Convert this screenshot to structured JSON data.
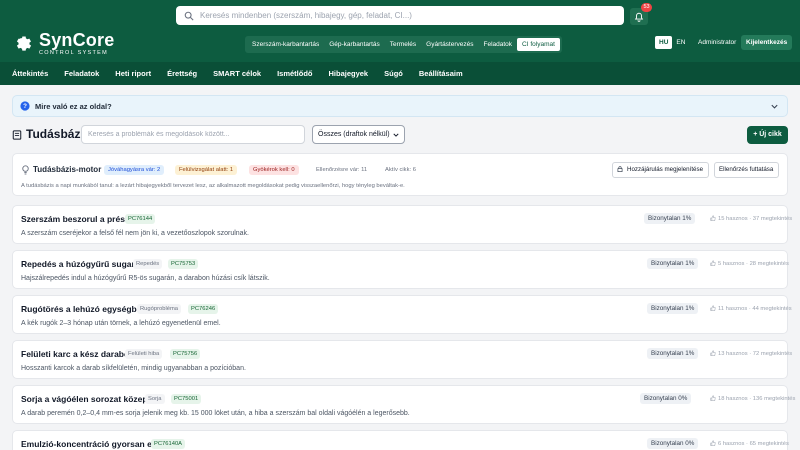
{
  "header": {
    "brand": "SynCore",
    "subbrand": "CONTROL SYSTEM",
    "search_placeholder": "Keresés mindenben (szerszám, hibajegy, gép, feladat, CI...)",
    "notifications_count": "53",
    "modules": [
      {
        "label": "Szerszám-karbantartás",
        "active": false
      },
      {
        "label": "Gép-karbantartás",
        "active": false
      },
      {
        "label": "Termelés",
        "active": false
      },
      {
        "label": "Gyártástervezés",
        "active": false
      },
      {
        "label": "Feladatok",
        "active": false
      },
      {
        "label": "CI folyamat",
        "active": true
      }
    ],
    "lang_hu": "HU",
    "lang_en": "EN",
    "user": "Administrator",
    "logout": "Kijelentkezés"
  },
  "nav": {
    "items": [
      "Áttekintés",
      "Feladatok",
      "Heti riport",
      "Érettség",
      "SMART célok",
      "Ismétlődő",
      "Hibajegyek",
      "Súgó",
      "Beállításaim"
    ]
  },
  "help": {
    "question": "Mire való ez az oldal?"
  },
  "page": {
    "title": "Tudásbázis",
    "search_placeholder": "Keresés a problémák és megoldások között...",
    "filter_value": "Összes (draftok nélkül)",
    "new_button": "+ Új cikk"
  },
  "engine": {
    "title": "Tudásbázis-motor",
    "pending": "Jóváhagyásra vár: 2",
    "review": "Felülvizsgálat alatt: 1",
    "root_cause": "Gyökérok kell: 0",
    "to_check": "Ellenőrzésre vár: 11",
    "active": "Aktív cikk: 6",
    "description": "A tudásbázis a napi munkából tanul: a lezárt hibajegyekből tervezet lesz, az alkalmazott megoldásokat pedig visszaellenőrzi, hogy tényleg beváltak-e.",
    "btn_contrib": "Hozzájárulás megjelenítése",
    "btn_run": "Ellenőrzés futtatása"
  },
  "articles": [
    {
      "title": "Szerszám beszorul a présbe",
      "tag": "",
      "code": "PC76144",
      "desc": "A szerszám cseréjekor a felső fél nem jön ki, a vezetőoszlopok szorulnak.",
      "confidence": "Bizonytalan 1%",
      "stats": "15 hasznos · 37 megtekintés"
    },
    {
      "title": "Repedés a húzógyűrű sugarán",
      "tag": "Repedés",
      "code": "PC75753",
      "desc": "Hajszálrepedés indul a húzógyűrű R5-ös sugarán, a darabon húzási csík látszik.",
      "confidence": "Bizonytalan 1%",
      "stats": "5 hasznos · 28 megtekintés"
    },
    {
      "title": "Rugótörés a lehúzó egységben",
      "tag": "Rugóprobléma",
      "code": "PC76246",
      "desc": "A kék rugók 2–3 hónap után törnek, a lehúzó egyenetlenül emel.",
      "confidence": "Bizonytalan 1%",
      "stats": "11 hasznos · 44 megtekintés"
    },
    {
      "title": "Felületi karc a kész darabon",
      "tag": "Felületi hiba",
      "code": "PC75756",
      "desc": "Hosszanti karcok a darab síkfelületén, mindig ugyanabban a pozícióban.",
      "confidence": "Bizonytalan 1%",
      "stats": "13 hasznos · 72 megtekintés"
    },
    {
      "title": "Sorja a vágóélen sorozat közepén",
      "tag": "Sorja",
      "code": "PC75001",
      "desc": "A darab peremén 0,2–0,4 mm-es sorja jelenik meg kb. 15 000 löket után, a hiba a szerszám bal oldali vágóélén a legerősebb.",
      "confidence": "Bizonytalan 0%",
      "stats": "18 hasznos · 136 megtekintés"
    },
    {
      "title": "Emulzió-koncentráció gyorsan esik",
      "tag": "",
      "code": "PC76140A",
      "desc": "",
      "confidence": "Bizonytalan 0%",
      "stats": "6 hasznos · 65 megtekintés"
    }
  ]
}
